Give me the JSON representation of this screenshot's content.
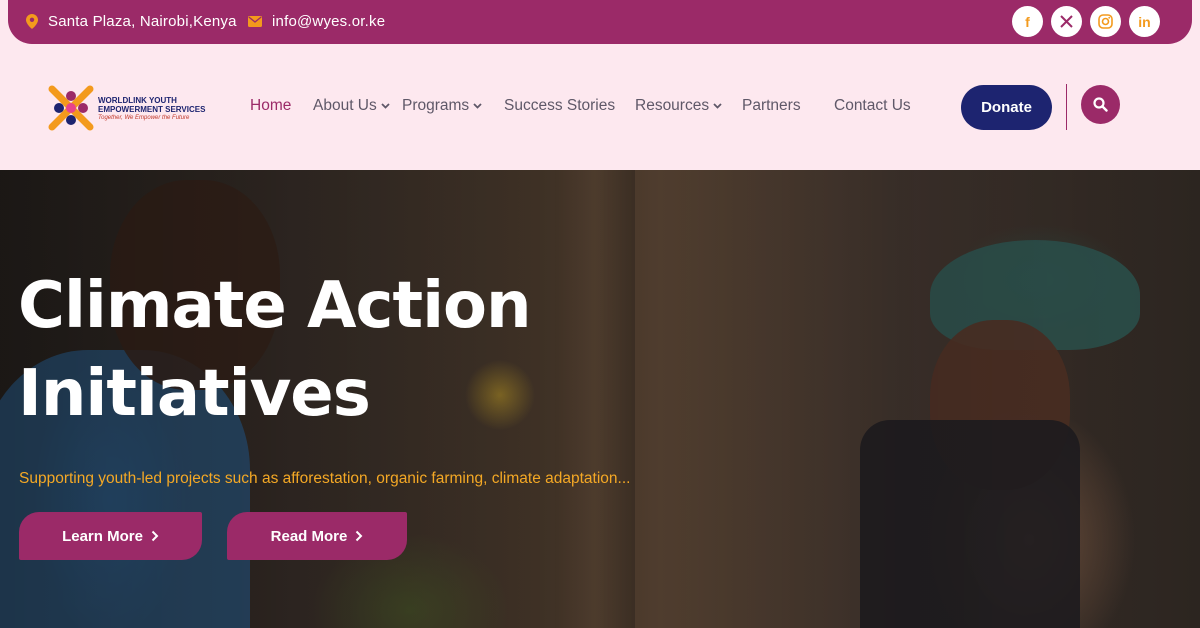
{
  "topbar": {
    "location": "Santa Plaza, Nairobi,Kenya",
    "email": "info@wyes.or.ke",
    "socials": [
      {
        "icon": "facebook-icon",
        "glyph": "f"
      },
      {
        "icon": "x-icon",
        "glyph": "𝕏"
      },
      {
        "icon": "instagram-icon",
        "glyph": "◎"
      },
      {
        "icon": "linkedin-icon",
        "glyph": "in"
      }
    ],
    "accent_color": "#9b2a68",
    "icon_color": "#f39a1d"
  },
  "logo": {
    "line1": "WORLDLINK YOUTH",
    "line2": "EMPOWERMENT SERVICES",
    "tagline": "Together, We Empower the Future"
  },
  "nav": {
    "items": [
      {
        "label": "Home",
        "active": true,
        "dropdown": false
      },
      {
        "label": "About Us",
        "active": false,
        "dropdown": true
      },
      {
        "label": "Programs",
        "active": false,
        "dropdown": true
      },
      {
        "label": "Success Stories",
        "active": false,
        "dropdown": false
      },
      {
        "label": "Resources",
        "active": false,
        "dropdown": true
      },
      {
        "label": "Partners",
        "active": false,
        "dropdown": false
      },
      {
        "label": "Contact Us",
        "active": false,
        "dropdown": false
      }
    ],
    "donate_label": "Donate",
    "donate_color": "#1d2470"
  },
  "hero": {
    "title_line1": "Climate Action",
    "title_line2": "Initiatives",
    "subtitle": "Supporting youth-led projects such as afforestation, organic farming, climate adaptation...",
    "learn_more": "Learn More",
    "read_more": "Read More",
    "subtitle_color": "#f4a825"
  }
}
